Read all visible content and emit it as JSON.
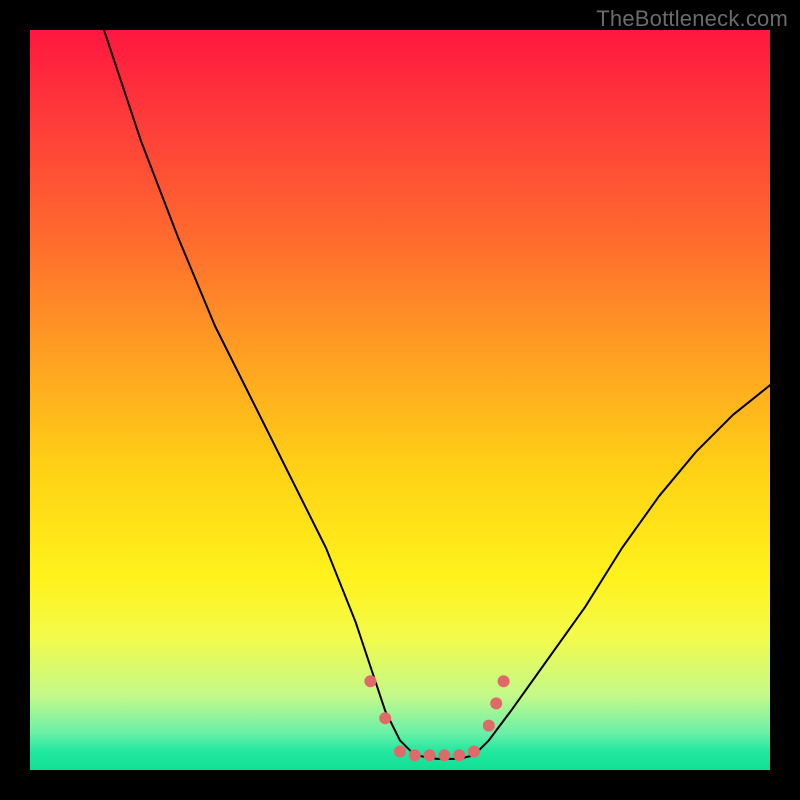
{
  "watermark": "TheBottleneck.com",
  "chart_data": {
    "type": "line",
    "title": "",
    "xlabel": "",
    "ylabel": "",
    "xlim": [
      0,
      100
    ],
    "ylim": [
      0,
      100
    ],
    "grid": false,
    "background": {
      "gradient_stops": [
        {
          "pos": 0.0,
          "color": "#ff173f"
        },
        {
          "pos": 0.12,
          "color": "#ff3b3a"
        },
        {
          "pos": 0.28,
          "color": "#ff6a2e"
        },
        {
          "pos": 0.45,
          "color": "#ffa321"
        },
        {
          "pos": 0.6,
          "color": "#ffd315"
        },
        {
          "pos": 0.74,
          "color": "#fff21c"
        },
        {
          "pos": 0.82,
          "color": "#f3fb4a"
        },
        {
          "pos": 0.9,
          "color": "#c3f98a"
        },
        {
          "pos": 0.95,
          "color": "#6af0a8"
        },
        {
          "pos": 0.975,
          "color": "#21e7a0"
        },
        {
          "pos": 1.0,
          "color": "#12df93"
        }
      ]
    },
    "series": [
      {
        "name": "bottleneck-curve",
        "stroke": "#000000",
        "stroke_width": 2,
        "x": [
          10,
          15,
          20,
          25,
          30,
          35,
          40,
          44,
          46,
          48,
          50,
          52,
          55,
          58,
          60,
          62,
          65,
          70,
          75,
          80,
          85,
          90,
          95,
          100
        ],
        "y": [
          100,
          85,
          72,
          60,
          50,
          40,
          30,
          20,
          14,
          8,
          4,
          2,
          1.5,
          1.5,
          2,
          4,
          8,
          15,
          22,
          30,
          37,
          43,
          48,
          52
        ]
      }
    ],
    "markers": {
      "name": "trough-dots",
      "color": "#e06a6a",
      "radius": 6,
      "points": [
        {
          "x": 46,
          "y": 12
        },
        {
          "x": 48,
          "y": 7
        },
        {
          "x": 50,
          "y": 2.5
        },
        {
          "x": 52,
          "y": 2
        },
        {
          "x": 54,
          "y": 2
        },
        {
          "x": 56,
          "y": 2
        },
        {
          "x": 58,
          "y": 2
        },
        {
          "x": 60,
          "y": 2.5
        },
        {
          "x": 62,
          "y": 6
        },
        {
          "x": 63,
          "y": 9
        },
        {
          "x": 64,
          "y": 12
        }
      ]
    }
  }
}
